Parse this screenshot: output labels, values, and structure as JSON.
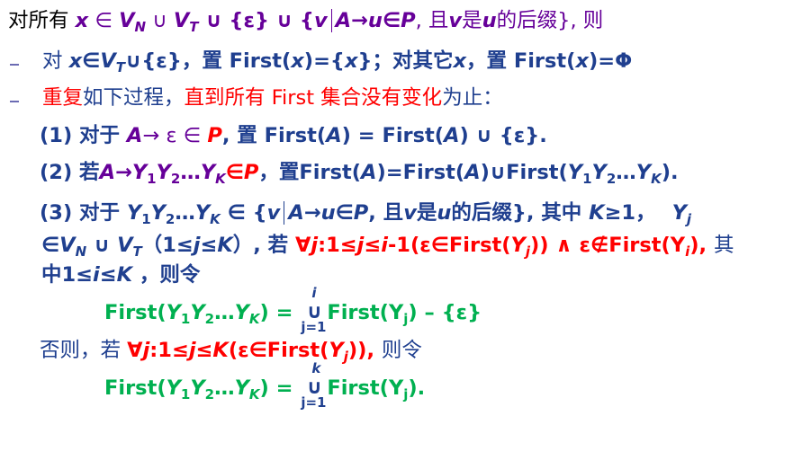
{
  "lines": [
    "对所有 x ∈ V_N ∪ V_T ∪ {ε} ∪ {v | A→u∈P, 且v是u的后缀}, 则",
    "对 x∈V_T∪{ε}，置 First(x)={x}；对其它x，置 First(x)=Φ",
    "重复如下过程，直到所有 First 集合没有变化为止：",
    "(1) 对于 A→ ε ∈ P, 置 First(A) = First(A) ∪ {ε}.",
    "(2) 若A→Y1Y2…YK∈P，置First(A)=First(A)∪First(Y1Y2…YK).",
    "(3) 对于 Y1Y2…YK ∈ {v | A→u∈P, 且v是u的后缀}, 其中 K≥1，Yj ∈VN ∪ VT（1≤j≤K）, 若 ∀j:1≤j≤i-1(ε∈First(Yj)) ∧ ε∉First(Yi), 其中1≤i≤K，则令",
    "First(Y1Y2…YK) = ∪ j=1 to i First(Yj) – {ε}",
    "否则，若 ∀j:1≤j≤K(ε∈First(Yj)), 则令",
    "First(Y1Y2…YK) = ∪ j=1 to k First(Yj)."
  ],
  "colors": {
    "purple": "#660099",
    "navy": "#1f3f8f",
    "red": "#ff0000",
    "green": "#00b050",
    "black": "#000000",
    "bullet": "#6b6bb3"
  },
  "text": {
    "l1a": "对所有 ",
    "l1b": "x",
    "l1c": " ∈ ",
    "l1d": "V",
    "l1e": "N",
    "l1f": " ∪ ",
    "l1g": "V",
    "l1h": "T",
    "l1i": " ∪ {ε} ∪ {",
    "l1j": "v",
    "l1k": "A",
    "l1l": "→",
    "l1m": "u",
    "l1n": "∈",
    "l1o": "P",
    "l1p": ", 且",
    "l1q": "v",
    "l1r": "是",
    "l1s": "u",
    "l1t": "的后缀}, 则",
    "l2a": "对 ",
    "l2b": "x",
    "l2c": "∈",
    "l2d": "V",
    "l2e": "T",
    "l2f": "∪{ε}，置 First(",
    "l2g": "x",
    "l2h": ")={",
    "l2i": "x",
    "l2j": "}；对其它",
    "l2k": "x",
    "l2l": "，置 First(",
    "l2m": "x",
    "l2n": ")=Φ",
    "l3a": "重复",
    "l3b": "如下过程，",
    "l3c": "直到所有 First 集合没有变化",
    "l3d": "为止：",
    "l4a": "(1) 对于 ",
    "l4b": "A",
    "l4c": "→ ε ∈ ",
    "l4d": "P",
    "l4e": ", 置 First(",
    "l4f": "A",
    "l4g": ") = First(",
    "l4h": "A",
    "l4i": ") ∪ {ε}.",
    "l5a": "(2) 若",
    "l5b": "A",
    "l5c": "→",
    "l5d": "Y",
    "l5e": "1",
    "l5f": "Y",
    "l5g": "2",
    "l5h": "…",
    "l5i": "Y",
    "l5j": "K",
    "l5k": "∈",
    "l5l": "P",
    "l5m": "，置First(",
    "l5n": "A",
    "l5o": ")=First(",
    "l5p": "A",
    "l5q": ")∪First(",
    "l5r": "Y",
    "l5s": "1",
    "l5t": "Y",
    "l5u": "2",
    "l5v": "…",
    "l5w": "Y",
    "l5x": "K",
    "l5y": ").",
    "l6a": "(3) 对于 ",
    "l6b": "Y",
    "l6c": "1",
    "l6d": "Y",
    "l6e": "2",
    "l6f": "…",
    "l6g": "Y",
    "l6h": "K",
    "l6i": " ∈ {",
    "l6j": "v",
    "l6k": "A",
    "l6l": "→",
    "l6m": "u",
    "l6n": "∈",
    "l6o": "P",
    "l6p": ", 且",
    "l6q": "v",
    "l6r": "是",
    "l6s": "u",
    "l6t": "的后缀}, 其中 ",
    "l6u": "K",
    "l6v": "≥1，",
    "l6w": "Y",
    "l6x": "j",
    "l7a": "∈",
    "l7b": "V",
    "l7c": "N",
    "l7d": " ∪ ",
    "l7e": "V",
    "l7f": "T",
    "l7g": "（1≤",
    "l7h": "j",
    "l7i": "≤",
    "l7j": "K",
    "l7k": "）, 若 ",
    "l7l": "∀",
    "l7m": "j",
    "l7n": ":1≤",
    "l7o": "j",
    "l7p": "≤",
    "l7q": "i",
    "l7r": "-1(ε∈First(",
    "l7s": "Y",
    "l7t": "j",
    "l7u": ")) ∧ ε∉First(Y",
    "l7v": "i",
    "l7w": "), ",
    "l7x": "其",
    "l8a": "中1≤",
    "l8b": "i",
    "l8c": "≤",
    "l8d": "K",
    "l8e": " ，则令",
    "l9a": "First(",
    "l9b": "Y",
    "l9c": "1",
    "l9d": "Y",
    "l9e": "2",
    "l9f": "…",
    "l9g": "Y",
    "l9h": "K",
    "l9i": ") = ",
    "l9up": "i",
    "l9sym": "∪",
    "l9lo": "j=1",
    "l9j": "First(Y",
    "l9k": "j",
    "l9l": ") – {ε}",
    "l10a": "否则，若 ",
    "l10b": "∀",
    "l10c": "j",
    "l10d": ":1≤",
    "l10e": "j",
    "l10f": "≤",
    "l10g": "K",
    "l10h": "(ε∈First(",
    "l10i": "Y",
    "l10j": "j",
    "l10k": ")), ",
    "l10l": "则令",
    "l11a": "First(",
    "l11b": "Y",
    "l11c": "1",
    "l11d": "Y",
    "l11e": "2",
    "l11f": "…",
    "l11g": "Y",
    "l11h": "K",
    "l11i": ") = ",
    "l11up": "k",
    "l11sym": "∪",
    "l11lo": "j=1",
    "l11j": "First(Y",
    "l11k": "j",
    "l11l": ")."
  }
}
